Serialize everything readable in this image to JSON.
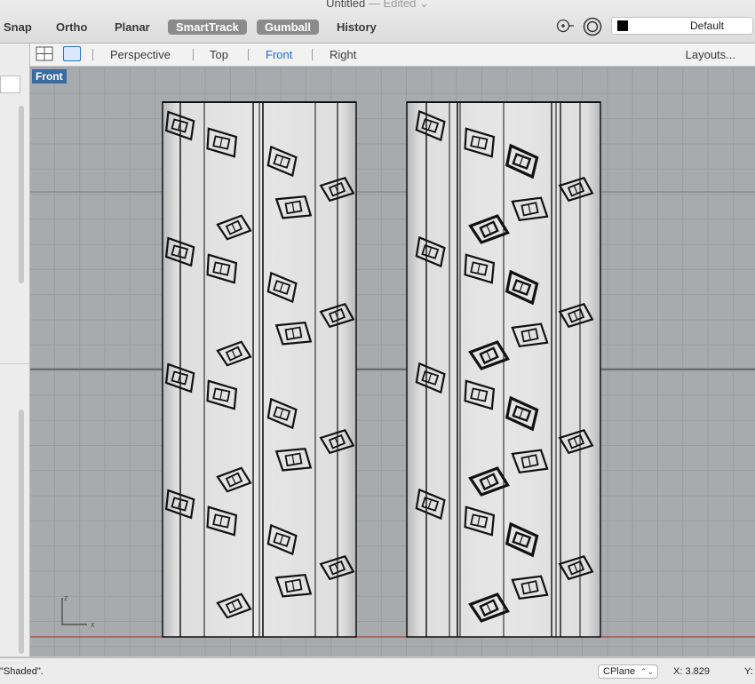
{
  "window": {
    "title": "Untitled",
    "edited": "— Edited ⌄"
  },
  "toolbar": {
    "modes": [
      {
        "label": "Snap",
        "on": false
      },
      {
        "label": "Ortho",
        "on": false
      },
      {
        "label": "Planar",
        "on": false
      },
      {
        "label": "SmartTrack",
        "on": true
      },
      {
        "label": "Gumball",
        "on": true
      },
      {
        "label": "History",
        "on": false
      }
    ],
    "layer": {
      "name": "Default",
      "color": "#000000"
    }
  },
  "viewport_tabs": {
    "tabs": [
      "Perspective",
      "Top",
      "Front",
      "Right"
    ],
    "active": "Front",
    "layouts_label": "Layouts..."
  },
  "viewport": {
    "name": "Front",
    "background": "#a8abae",
    "grid_color": "#9a9da1",
    "x_axis_color": "#b83a3a",
    "axis_labels": {
      "z": "z",
      "x": "x"
    }
  },
  "status": {
    "message": "\"Shaded\".",
    "cplane": "CPlane",
    "x": "X: 3.829",
    "y": "Y:"
  }
}
